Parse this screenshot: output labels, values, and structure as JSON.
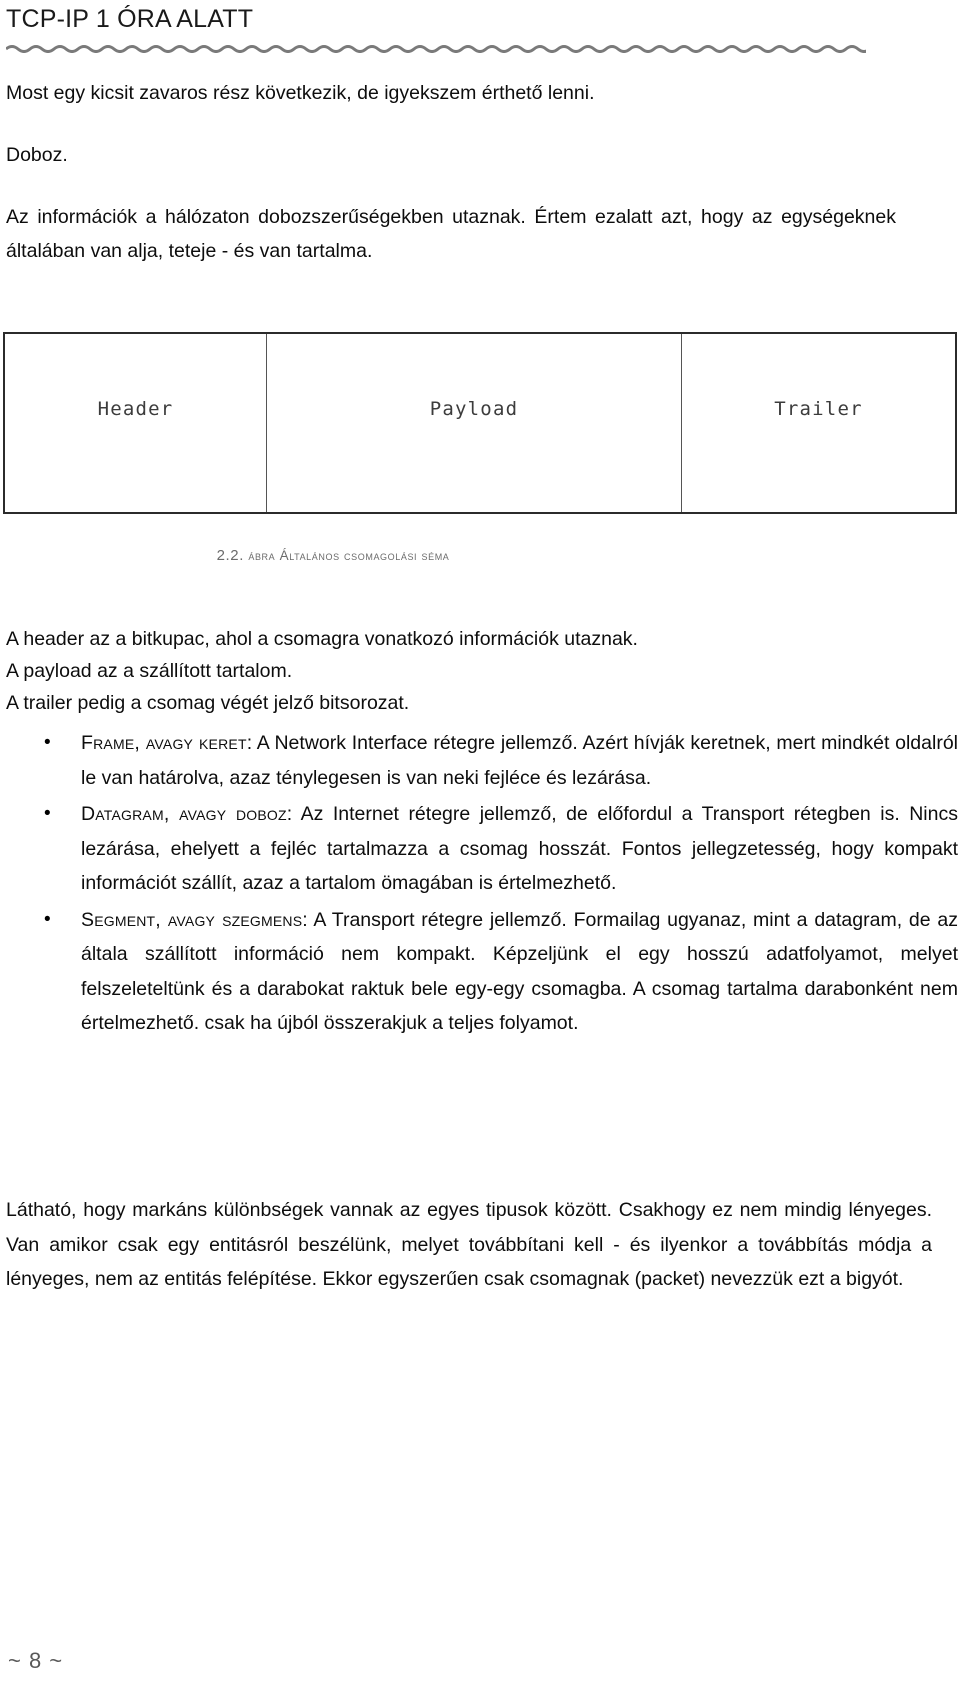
{
  "header": {
    "title": "TCP-IP 1 ÓRA ALATT",
    "rule_icon": "wavy-rule"
  },
  "body": {
    "intro": "Most egy kicsit zavaros rész következik, de igyekszem érthető lenni.",
    "doboz_heading": "Doboz.",
    "info_paragraph": "Az információk a hálózaton dobozszerűségekben utaznak. Értem ezalatt azt, hogy az egységeknek általában van alja, teteje - és van tartalma."
  },
  "figure": {
    "cells": [
      {
        "label": "Header"
      },
      {
        "label": "Payload"
      },
      {
        "label": "Trailer"
      }
    ],
    "caption_number": "2.2.",
    "caption_text": "ábra Általános csomagolási séma"
  },
  "statements": [
    "A header az a bitkupac, ahol a csomagra vonatkozó információk utaznak.",
    "A payload az a szállított tartalom.",
    "A trailer pedig a csomag végét jelző bitsorozat."
  ],
  "bullets": [
    {
      "term": "Frame, avagy keret",
      "separator": ": ",
      "text": "A Network Interface rétegre jellemző. Azért hívják keretnek, mert mindkét oldalról le van határolva, azaz ténylegesen is van neki fejléce és lezárása."
    },
    {
      "term": "Datagram, avagy doboz",
      "separator": ": ",
      "text": "Az Internet rétegre jellemző, de előfordul a Transport rétegben is. Nincs lezárása, ehelyett a fejléc tartalmazza a csomag hosszát. Fontos jellegzetesség, hogy kompakt információt szállít, azaz a tartalom ömagában is értelmezhető."
    },
    {
      "term": "Segment, avagy szegmens",
      "separator": ": ",
      "text": "A Transport rétegre jellemző. Formailag ugyanaz, mint a datagram, de az általa szállított információ nem kompakt. Képzeljünk el egy hosszú adatfolyamot, melyet felszeleteltünk és a darabokat raktuk bele egy-egy csomagba. A csomag tartalma darabonként nem értelmezhető. csak ha újból összerakjuk a teljes folyamot."
    }
  ],
  "closing": "Látható, hogy markáns különbségek vannak az egyes tipusok között. Csakhogy ez nem mindig lényeges. Van amikor csak egy entitásról beszélünk, melyet továbbítani kell - és ilyenkor a továbbítás módja a lényeges, nem az entitás felépítése. Ekkor egyszerűen csak csomagnak (packet) nevezzük ezt a bigyót.",
  "footer": {
    "page_marker": "~ 8 ~"
  },
  "colors": {
    "text": "#0d0d0d",
    "caption": "#6b6b6b",
    "rule": "#7a7a7a",
    "box_border": "#2b2b2b",
    "footer": "#595959"
  }
}
